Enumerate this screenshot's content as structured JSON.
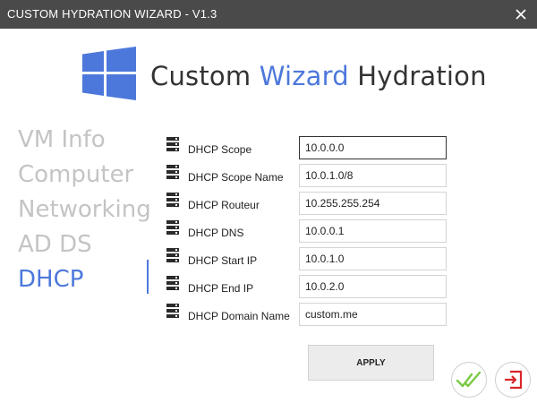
{
  "window": {
    "title": "CUSTOM HYDRATION WIZARD - V1.3"
  },
  "header": {
    "part1": "Custom ",
    "accent": "Wizard",
    "part2": " Hydration"
  },
  "nav": {
    "items": [
      {
        "label": "VM Info",
        "active": false
      },
      {
        "label": "Computer",
        "active": false
      },
      {
        "label": "Networking",
        "active": false
      },
      {
        "label": "AD DS",
        "active": false
      },
      {
        "label": "DHCP",
        "active": true
      }
    ]
  },
  "form": {
    "fields": [
      {
        "label": "DHCP Scope",
        "value": "10.0.0.0"
      },
      {
        "label": "DHCP Scope Name",
        "value": "10.0.1.0/8"
      },
      {
        "label": "DHCP Routeur",
        "value": "10.255.255.254"
      },
      {
        "label": "DHCP DNS",
        "value": "10.0.0.1"
      },
      {
        "label": "DHCP Start IP",
        "value": "10.0.1.0"
      },
      {
        "label": "DHCP End IP",
        "value": "10.0.2.0"
      },
      {
        "label": "DHCP Domain Name",
        "value": "custom.me"
      }
    ],
    "field_icon": "server-icon"
  },
  "actions": {
    "apply_label": "APPLY",
    "ok_icon": "double-check-icon",
    "exit_icon": "exit-icon"
  },
  "colors": {
    "accent": "#4d78db",
    "titlebar": "#4a4a4a",
    "nav_inactive": "#c4c4c4",
    "ok_green": "#7ac943",
    "exit_red": "#d9262b"
  }
}
